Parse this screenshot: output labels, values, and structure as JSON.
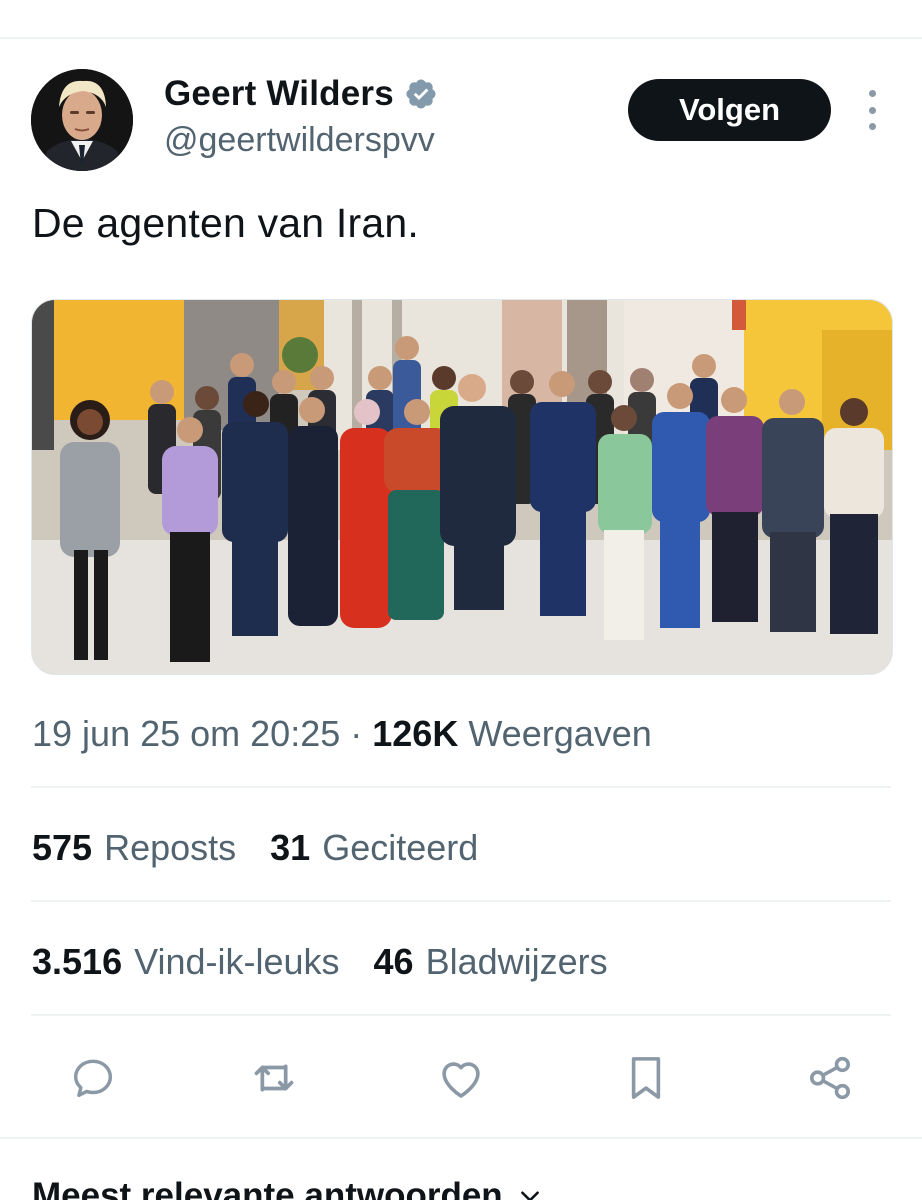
{
  "author": {
    "name": "Geert Wilders",
    "handle": "@geertwilderspvv",
    "verified": true
  },
  "follow_button_label": "Volgen",
  "tweet_text": "De agenten van Iran.",
  "meta": {
    "timestamp": "19 jun 25 om 20:25",
    "separator": "·",
    "views_count": "126K",
    "views_label": "Weergaven"
  },
  "stats_row1": [
    {
      "count": "575",
      "label": "Reposts"
    },
    {
      "count": "31",
      "label": "Geciteerd"
    }
  ],
  "stats_row2": [
    {
      "count": "3.516",
      "label": "Vind-ik-leuks"
    },
    {
      "count": "46",
      "label": "Bladwijzers"
    }
  ],
  "actions": [
    "reply-icon",
    "repost-icon",
    "like-icon",
    "bookmark-icon",
    "share-icon"
  ],
  "replies_header": "Meest relevante antwoorden",
  "colors": {
    "text_primary": "#0f1419",
    "text_secondary": "#536471",
    "verified_badge": "#829aab",
    "divider": "#eff3f4",
    "icon_gray": "#8b98a5"
  }
}
